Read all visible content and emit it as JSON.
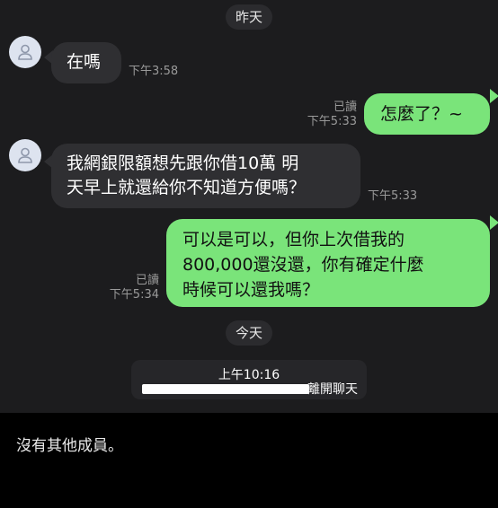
{
  "date_dividers": {
    "yesterday": "昨天",
    "today": "今天"
  },
  "messages": [
    {
      "direction": "incoming",
      "text": "在嗎",
      "time": "下午3:58"
    },
    {
      "direction": "outgoing",
      "text": "怎麼了？~",
      "read": "已讀",
      "time": "下午5:33"
    },
    {
      "direction": "incoming",
      "lines": [
        "我網銀限額想先跟你借10萬 明",
        "天早上就還給你不知道方便嗎？"
      ],
      "time": "下午5:33"
    },
    {
      "direction": "outgoing",
      "lines": [
        "可以是可以，但你上次借我的",
        "800,000還沒還，你有確定什麼",
        "時候可以還我嗎？"
      ],
      "read": "已讀",
      "time": "下午5:34"
    }
  ],
  "system_notice": {
    "time": "上午10:16",
    "action": "離開聊天"
  },
  "footer": {
    "text": "沒有其他成員。"
  },
  "colors": {
    "outgoing_bubble": "#7ae47a",
    "incoming_bubble": "#2f2f32",
    "background": "#1c1c1e"
  }
}
